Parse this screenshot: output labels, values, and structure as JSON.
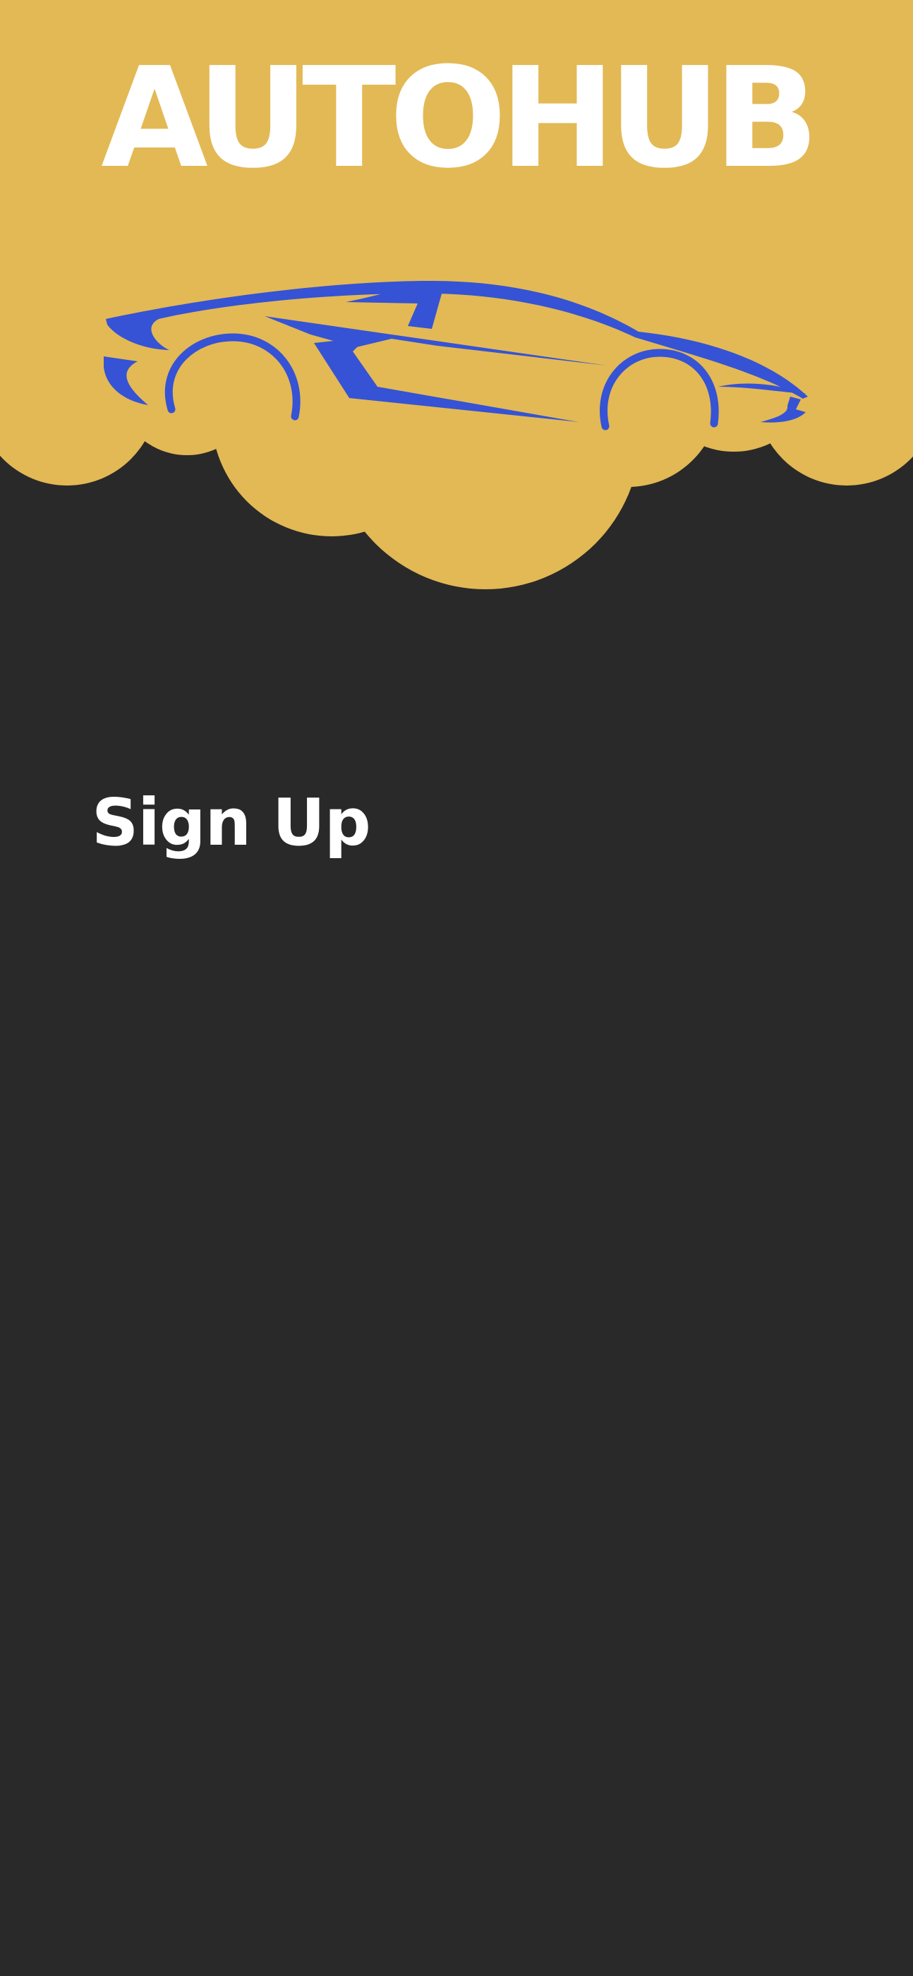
{
  "app": {
    "brand_name": "AUTOHUB",
    "logo_icon": "sports-car-icon"
  },
  "page": {
    "title": "Sign Up"
  },
  "colors": {
    "background": "#292929",
    "header": "#E3B955",
    "logo_car": "#3553D4",
    "text": "#FFFFFF"
  }
}
